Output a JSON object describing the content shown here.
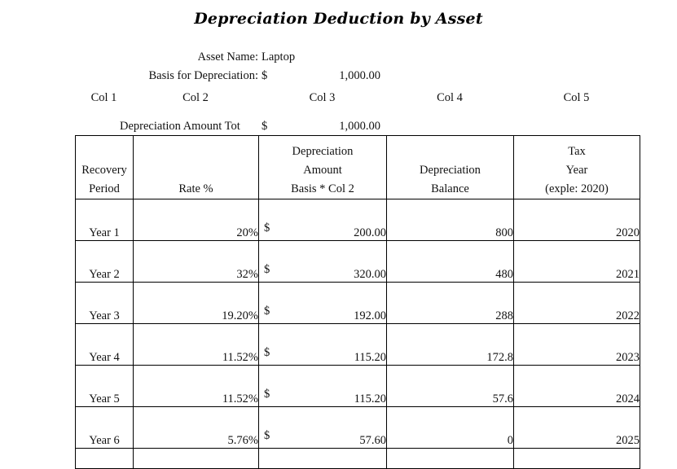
{
  "title": "Depreciation Deduction by Asset",
  "info": {
    "asset_name_label": "Asset Name:",
    "asset_name_value": "Laptop",
    "basis_label": "Basis for Depreciation:",
    "basis_currency": "$",
    "basis_value": "1,000.00",
    "total_label": "Depreciation Amount Tot",
    "total_currency": "$",
    "total_value": "1,000.00"
  },
  "col_markers": [
    "Col 1",
    "Col 2",
    "Col 3",
    "Col 4",
    "Col 5"
  ],
  "table": {
    "headers": [
      {
        "lines": [
          "Recovery",
          "Period"
        ]
      },
      {
        "lines": [
          "Rate %"
        ]
      },
      {
        "lines": [
          "Depreciation",
          "Amount",
          "Basis * Col 2"
        ]
      },
      {
        "lines": [
          "Depreciation",
          "Balance"
        ]
      },
      {
        "lines": [
          "Tax",
          "Year",
          "(exple: 2020)"
        ]
      }
    ],
    "rows": [
      {
        "recovery": "Year 1",
        "rate": "20%",
        "currency": "$",
        "amount": "200.00",
        "balance": "800",
        "tax_year": "2020"
      },
      {
        "recovery": "Year 2",
        "rate": "32%",
        "currency": "$",
        "amount": "320.00",
        "balance": "480",
        "tax_year": "2021"
      },
      {
        "recovery": "Year 3",
        "rate": "19.20%",
        "currency": "$",
        "amount": "192.00",
        "balance": "288",
        "tax_year": "2022"
      },
      {
        "recovery": "Year 4",
        "rate": "11.52%",
        "currency": "$",
        "amount": "115.20",
        "balance": "172.8",
        "tax_year": "2023"
      },
      {
        "recovery": "Year 5",
        "rate": "11.52%",
        "currency": "$",
        "amount": "115.20",
        "balance": "57.6",
        "tax_year": "2024"
      },
      {
        "recovery": "Year 6",
        "rate": "5.76%",
        "currency": "$",
        "amount": "57.60",
        "balance": "0",
        "tax_year": "2025"
      },
      {
        "recovery": "",
        "rate": "",
        "currency": "",
        "amount": "",
        "balance": "",
        "tax_year": ""
      }
    ]
  },
  "chart_data": {
    "type": "table",
    "title": "Depreciation Deduction by Asset",
    "asset": "Laptop",
    "basis": 1000.0,
    "total_depreciation": 1000.0,
    "columns": [
      "Recovery Period",
      "Rate %",
      "Depreciation Amount (Basis * Col 2)",
      "Depreciation Balance",
      "Tax Year"
    ],
    "rows": [
      [
        "Year 1",
        20.0,
        200.0,
        800,
        2020
      ],
      [
        "Year 2",
        32.0,
        320.0,
        480,
        2021
      ],
      [
        "Year 3",
        19.2,
        192.0,
        288,
        2022
      ],
      [
        "Year 4",
        11.52,
        115.2,
        172.8,
        2023
      ],
      [
        "Year 5",
        11.52,
        115.2,
        57.6,
        2024
      ],
      [
        "Year 6",
        5.76,
        57.6,
        0,
        2025
      ]
    ]
  }
}
